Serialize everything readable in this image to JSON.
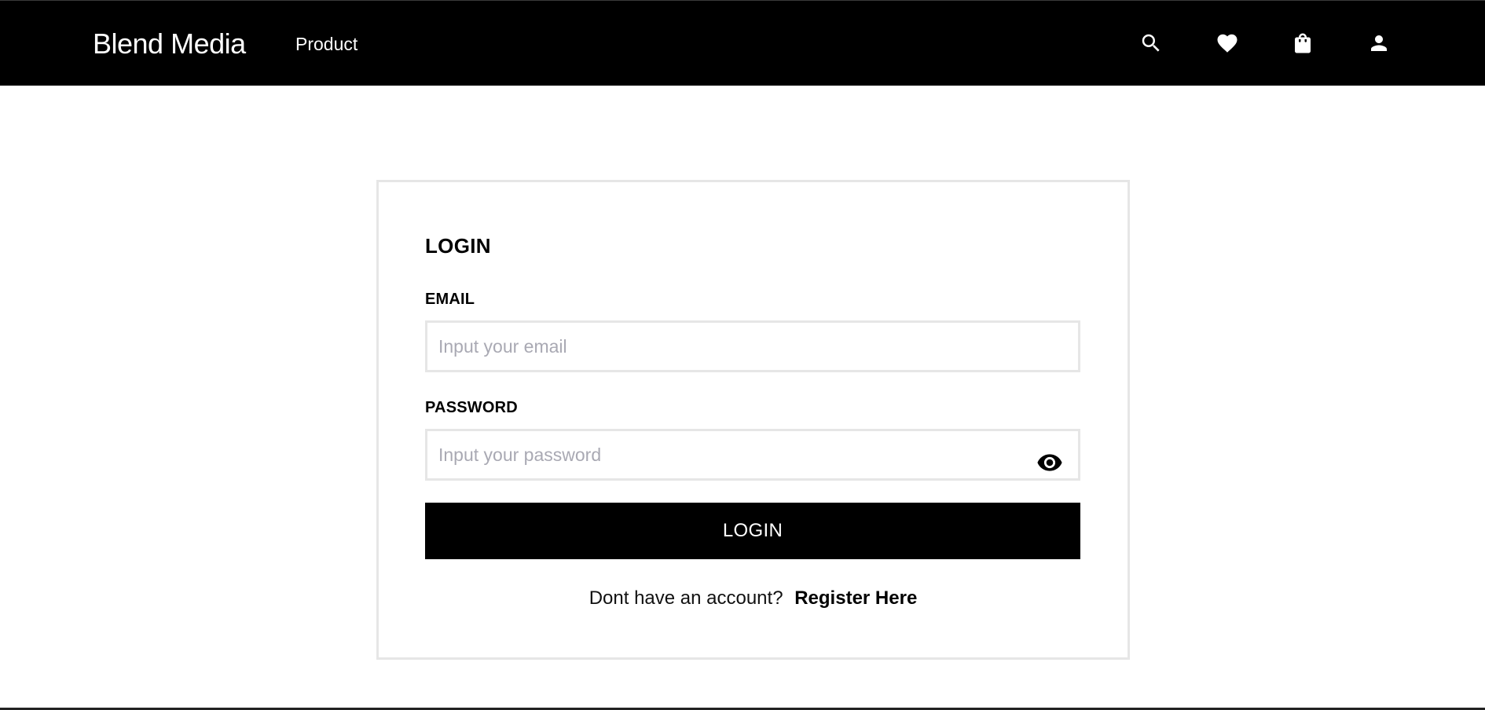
{
  "header": {
    "brand": "Blend Media",
    "nav_product": "Product",
    "icons": [
      "search-icon",
      "heart-icon",
      "shopping-bag-icon",
      "user-icon"
    ]
  },
  "login": {
    "title": "LOGIN",
    "email_label": "EMAIL",
    "email_placeholder": "Input your email",
    "email_value": "",
    "password_label": "PASSWORD",
    "password_placeholder": "Input your password",
    "password_value": "",
    "password_toggle_icon": "eye-icon",
    "submit_label": "LOGIN",
    "register_prompt": "Dont have an account?",
    "register_link": "Register Here"
  },
  "colors": {
    "header_bg": "#000000",
    "card_border": "#e6e6e6",
    "button_bg": "#000000",
    "placeholder": "#a9a9b3"
  }
}
